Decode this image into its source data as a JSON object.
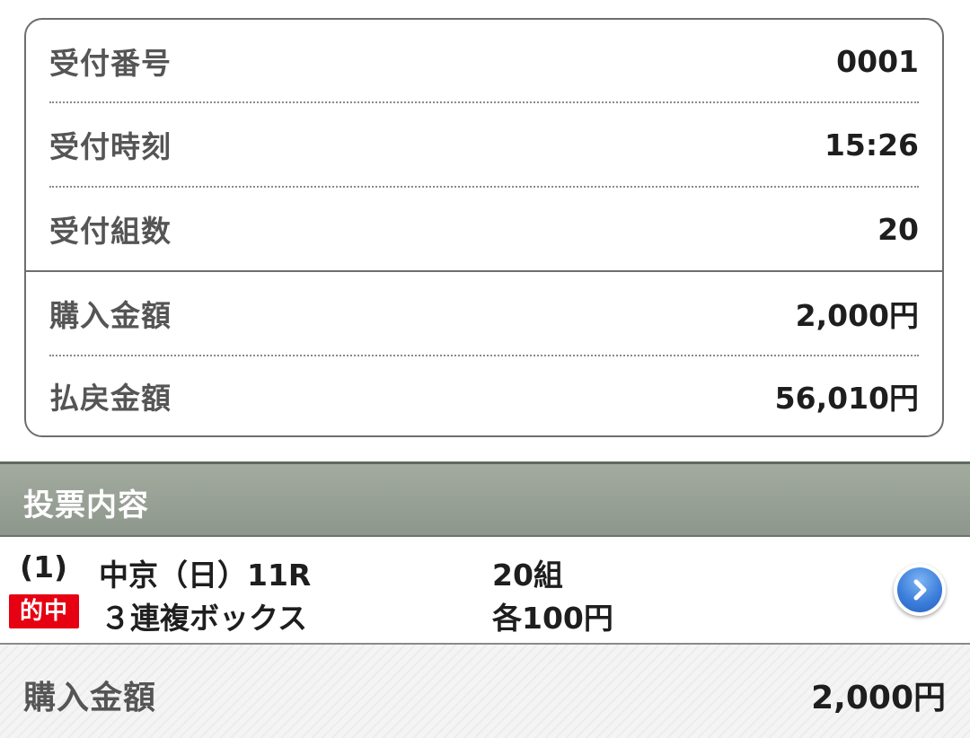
{
  "summary": {
    "receipt_number_label": "受付番号",
    "receipt_number_value": "0001",
    "receipt_time_label": "受付時刻",
    "receipt_time_value": "15:26",
    "receipt_count_label": "受付組数",
    "receipt_count_value": "20",
    "purchase_amount_label": "購入金額",
    "purchase_amount_value": "2,000円",
    "payout_amount_label": "払戻金額",
    "payout_amount_value": "56,010円"
  },
  "section": {
    "title": "投票内容"
  },
  "bet": {
    "index": "(1)",
    "race": "中京（日）11R",
    "combinations": "20組",
    "hit_badge": "的中",
    "bet_type": "３連複ボックス",
    "unit_price": "各100円",
    "arrow_icon": "chevron-right-circle-icon"
  },
  "footer": {
    "total_label": "購入金額",
    "total_value": "2,000円"
  },
  "colors": {
    "hit_badge": "#e60012",
    "section_header": "#949d91",
    "arrow_button": "#3d7fdb"
  }
}
